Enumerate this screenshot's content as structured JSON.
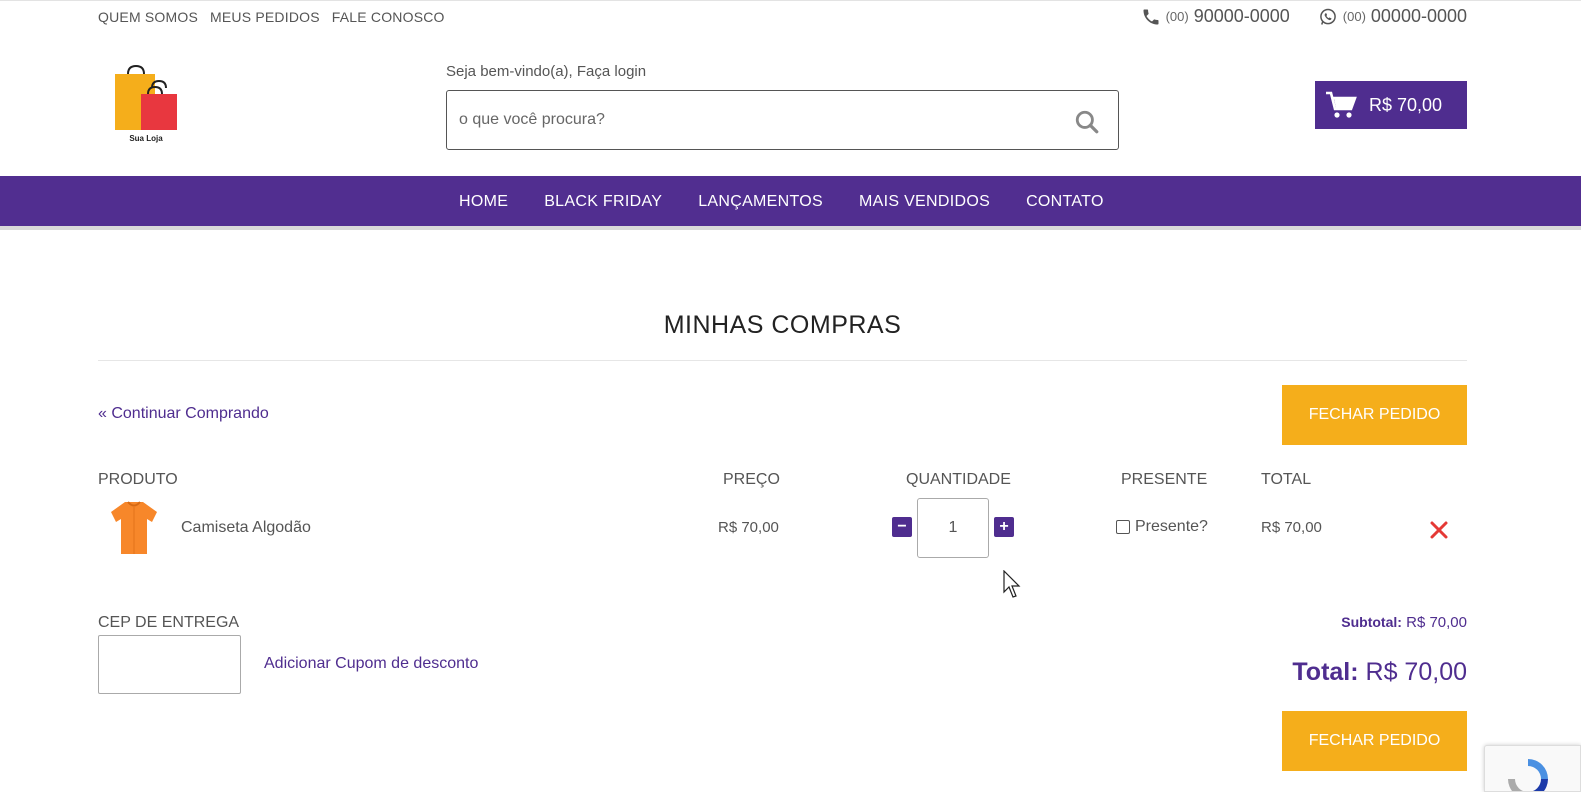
{
  "topbar": {
    "links": [
      "QUEM SOMOS",
      "MEUS PEDIDOS",
      "FALE CONOSCO"
    ],
    "phone": {
      "ddd": "(00)",
      "number": "90000-0000",
      "icon": "phone-icon"
    },
    "whatsapp": {
      "ddd": "(00)",
      "number": "00000-0000",
      "icon": "whatsapp-icon"
    }
  },
  "header": {
    "logo_text": "Sua Loja",
    "welcome": "Seja bem-vindo(a), Faça login",
    "search_placeholder": "o que você procura?",
    "cart_total": "R$ 70,00"
  },
  "nav": [
    "HOME",
    "BLACK FRIDAY",
    "LANÇAMENTOS",
    "MAIS VENDIDOS",
    "CONTATO"
  ],
  "cart": {
    "title": "MINHAS COMPRAS",
    "continue_link": "« Continuar Comprando",
    "checkout_label": "FECHAR PEDIDO",
    "columns": [
      "PRODUTO",
      "PREÇO",
      "QUANTIDADE",
      "PRESENTE",
      "TOTAL"
    ],
    "items": [
      {
        "name": "Camiseta Algodão",
        "price": "R$ 70,00",
        "quantity": "1",
        "gift_label": "Presente?",
        "gift_checked": false,
        "total": "R$ 70,00"
      }
    ],
    "cep_label": "CEP DE ENTREGA",
    "coupon_link": "Adicionar Cupom de desconto",
    "subtotal_label": "Subtotal:",
    "subtotal_value": "R$ 70,00",
    "total_label": "Total:",
    "total_value": "R$ 70,00"
  },
  "colors": {
    "brand": "#512e90",
    "accent": "#f5ae1b",
    "remove": "#e53935"
  }
}
